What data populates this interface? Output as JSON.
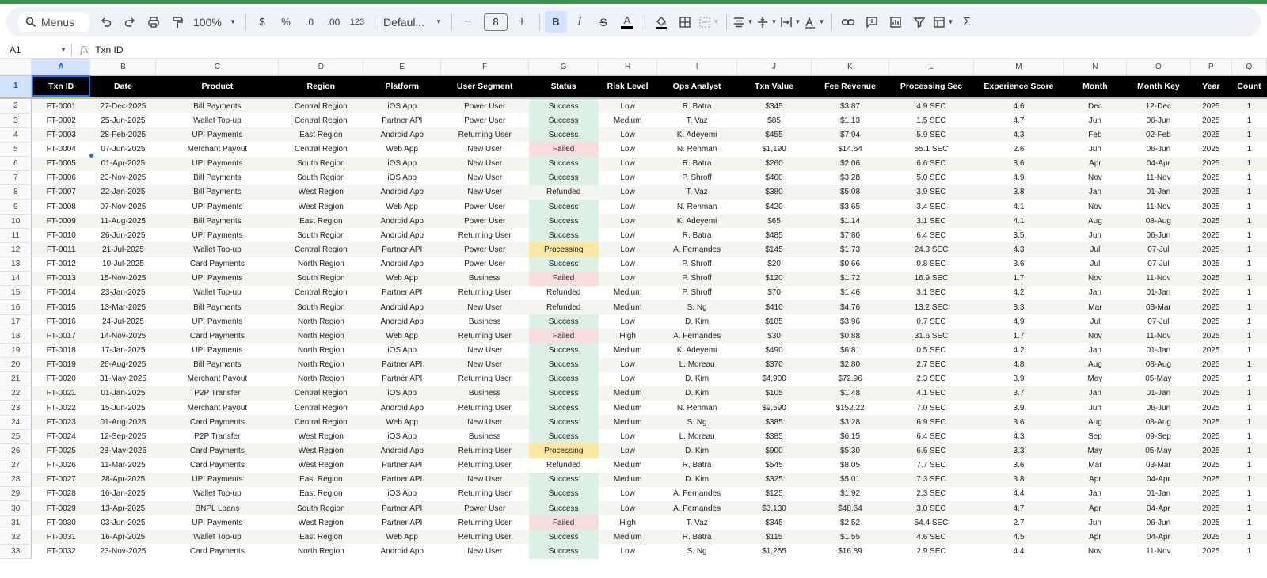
{
  "toolbar": {
    "menus_label": "Menus",
    "zoom": "100%",
    "currency": "$",
    "percent": "%",
    "dec_decrease": ".0",
    "dec_increase": ".00",
    "number_format": "123",
    "font": "Defaul...",
    "font_size": "8",
    "bold": "B",
    "italic": "I",
    "strikethrough": "S",
    "text_color": "A",
    "sigma": "Σ",
    "minus": "−",
    "plus": "+"
  },
  "formula_bar": {
    "cell_ref": "A1",
    "fx": "fx",
    "content": "Txn ID"
  },
  "column_letters": [
    "A",
    "B",
    "C",
    "D",
    "E",
    "F",
    "G",
    "H",
    "I",
    "J",
    "K",
    "L",
    "M",
    "N",
    "O",
    "P",
    "Q"
  ],
  "header_row_number": "1",
  "headers": [
    "Txn ID",
    "Date",
    "Product",
    "Region",
    "Platform",
    "User Segment",
    "Status",
    "Risk Level",
    "Ops Analyst",
    "Txn Value",
    "Fee Revenue",
    "Processing Sec",
    "Experience Score",
    "Month",
    "Month Key",
    "Year",
    "Count"
  ],
  "rows": [
    [
      "2",
      "FT-0001",
      "27-Dec-2025",
      "Bill Payments",
      "Central Region",
      "iOS App",
      "Power User",
      "Success",
      "Low",
      "R. Batra",
      "$345",
      "$3.87",
      "4.9 SEC",
      "4.6",
      "Dec",
      "12-Dec",
      "2025",
      "1"
    ],
    [
      "3",
      "FT-0002",
      "25-Jun-2025",
      "Wallet Top-up",
      "Central Region",
      "Partner API",
      "Power User",
      "Success",
      "Medium",
      "T. Vaz",
      "$85",
      "$1.13",
      "1.5 SEC",
      "4.7",
      "Jun",
      "06-Jun",
      "2025",
      "1"
    ],
    [
      "4",
      "FT-0003",
      "28-Feb-2025",
      "UPI Payments",
      "East Region",
      "Android App",
      "Returning User",
      "Success",
      "Low",
      "K. Adeyemi",
      "$455",
      "$7.94",
      "5.9 SEC",
      "4.3",
      "Feb",
      "02-Feb",
      "2025",
      "1"
    ],
    [
      "5",
      "FT-0004",
      "07-Jun-2025",
      "Merchant Payout",
      "Central Region",
      "Web App",
      "New User",
      "Failed",
      "Low",
      "N. Rehman",
      "$1,190",
      "$14.64",
      "55.1 SEC",
      "2.6",
      "Jun",
      "06-Jun",
      "2025",
      "1"
    ],
    [
      "6",
      "FT-0005",
      "01-Apr-2025",
      "UPI Payments",
      "South Region",
      "iOS App",
      "New User",
      "Success",
      "Low",
      "R. Batra",
      "$260",
      "$2.06",
      "6.6 SEC",
      "3.6",
      "Apr",
      "04-Apr",
      "2025",
      "1"
    ],
    [
      "7",
      "FT-0006",
      "23-Nov-2025",
      "Bill Payments",
      "South Region",
      "iOS App",
      "New User",
      "Success",
      "Low",
      "P. Shroff",
      "$460",
      "$3.28",
      "5.0 SEC",
      "4.9",
      "Nov",
      "11-Nov",
      "2025",
      "1"
    ],
    [
      "8",
      "FT-0007",
      "22-Jan-2025",
      "Bill Payments",
      "West Region",
      "Android App",
      "New User",
      "Refunded",
      "Low",
      "T. Vaz",
      "$380",
      "$5.08",
      "3.9 SEC",
      "3.8",
      "Jan",
      "01-Jan",
      "2025",
      "1"
    ],
    [
      "9",
      "FT-0008",
      "07-Nov-2025",
      "UPI Payments",
      "West Region",
      "Web App",
      "Power User",
      "Success",
      "Low",
      "N. Rehman",
      "$420",
      "$3.65",
      "3.4 SEC",
      "4.1",
      "Nov",
      "11-Nov",
      "2025",
      "1"
    ],
    [
      "10",
      "FT-0009",
      "11-Aug-2025",
      "Bill Payments",
      "East Region",
      "Android App",
      "Power User",
      "Success",
      "Low",
      "K. Adeyemi",
      "$65",
      "$1.14",
      "3.1 SEC",
      "4.1",
      "Aug",
      "08-Aug",
      "2025",
      "1"
    ],
    [
      "11",
      "FT-0010",
      "26-Jun-2025",
      "UPI Payments",
      "South Region",
      "Android App",
      "Returning User",
      "Success",
      "Low",
      "R. Batra",
      "$485",
      "$7.80",
      "6.4 SEC",
      "3.5",
      "Jun",
      "06-Jun",
      "2025",
      "1"
    ],
    [
      "12",
      "FT-0011",
      "21-Jul-2025",
      "Wallet Top-up",
      "Central Region",
      "Partner API",
      "Power User",
      "Processing",
      "Low",
      "A. Fernandes",
      "$145",
      "$1.73",
      "24.3 SEC",
      "4.3",
      "Jul",
      "07-Jul",
      "2025",
      "1"
    ],
    [
      "13",
      "FT-0012",
      "10-Jul-2025",
      "Card Payments",
      "North Region",
      "Android App",
      "Power User",
      "Success",
      "Low",
      "P. Shroff",
      "$20",
      "$0.66",
      "0.8 SEC",
      "3.6",
      "Jul",
      "07-Jul",
      "2025",
      "1"
    ],
    [
      "14",
      "FT-0013",
      "15-Nov-2025",
      "UPI Payments",
      "South Region",
      "Web App",
      "Business",
      "Failed",
      "Low",
      "P. Shroff",
      "$120",
      "$1.72",
      "16.9 SEC",
      "1.7",
      "Nov",
      "11-Nov",
      "2025",
      "1"
    ],
    [
      "15",
      "FT-0014",
      "23-Jan-2025",
      "Wallet Top-up",
      "Central Region",
      "Partner API",
      "Returning User",
      "Refunded",
      "Medium",
      "P. Shroff",
      "$70",
      "$1.46",
      "3.1 SEC",
      "4.2",
      "Jan",
      "01-Jan",
      "2025",
      "1"
    ],
    [
      "16",
      "FT-0015",
      "13-Mar-2025",
      "Bill Payments",
      "South Region",
      "Android App",
      "New User",
      "Refunded",
      "Medium",
      "S. Ng",
      "$410",
      "$4.76",
      "13.2 SEC",
      "3.3",
      "Mar",
      "03-Mar",
      "2025",
      "1"
    ],
    [
      "17",
      "FT-0016",
      "24-Jul-2025",
      "UPI Payments",
      "North Region",
      "Android App",
      "Business",
      "Success",
      "Low",
      "D. Kim",
      "$185",
      "$3.96",
      "0.7 SEC",
      "4.9",
      "Jul",
      "07-Jul",
      "2025",
      "1"
    ],
    [
      "18",
      "FT-0017",
      "14-Nov-2025",
      "Card Payments",
      "North Region",
      "Web App",
      "Returning User",
      "Failed",
      "High",
      "A. Fernandes",
      "$30",
      "$0.88",
      "31.6 SEC",
      "1.7",
      "Nov",
      "11-Nov",
      "2025",
      "1"
    ],
    [
      "19",
      "FT-0018",
      "17-Jan-2025",
      "UPI Payments",
      "North Region",
      "iOS App",
      "New User",
      "Success",
      "Medium",
      "K. Adeyemi",
      "$490",
      "$6.81",
      "0.5 SEC",
      "4.2",
      "Jan",
      "01-Jan",
      "2025",
      "1"
    ],
    [
      "20",
      "FT-0019",
      "26-Aug-2025",
      "Bill Payments",
      "North Region",
      "Partner API",
      "New User",
      "Success",
      "Low",
      "L. Moreau",
      "$370",
      "$2.80",
      "2.7 SEC",
      "4.8",
      "Aug",
      "08-Aug",
      "2025",
      "1"
    ],
    [
      "21",
      "FT-0020",
      "31-May-2025",
      "Merchant Payout",
      "North Region",
      "Partner API",
      "Returning User",
      "Success",
      "Low",
      "D. Kim",
      "$4,900",
      "$72.96",
      "2.3 SEC",
      "3.9",
      "May",
      "05-May",
      "2025",
      "1"
    ],
    [
      "22",
      "FT-0021",
      "01-Jan-2025",
      "P2P Transfer",
      "Central Region",
      "iOS App",
      "Business",
      "Success",
      "Medium",
      "D. Kim",
      "$105",
      "$1.48",
      "4.1 SEC",
      "3.7",
      "Jan",
      "01-Jan",
      "2025",
      "1"
    ],
    [
      "23",
      "FT-0022",
      "15-Jun-2025",
      "Merchant Payout",
      "Central Region",
      "Android App",
      "Returning User",
      "Success",
      "Medium",
      "N. Rehman",
      "$9,590",
      "$152.22",
      "7.0 SEC",
      "3.9",
      "Jun",
      "06-Jun",
      "2025",
      "1"
    ],
    [
      "24",
      "FT-0023",
      "01-Aug-2025",
      "Card Payments",
      "Central Region",
      "Web App",
      "New User",
      "Success",
      "Medium",
      "S. Ng",
      "$385",
      "$3.28",
      "6.9 SEC",
      "3.6",
      "Aug",
      "08-Aug",
      "2025",
      "1"
    ],
    [
      "25",
      "FT-0024",
      "12-Sep-2025",
      "P2P Transfer",
      "West Region",
      "iOS App",
      "Business",
      "Success",
      "Low",
      "L. Moreau",
      "$385",
      "$6.15",
      "6.4 SEC",
      "4.3",
      "Sep",
      "09-Sep",
      "2025",
      "1"
    ],
    [
      "26",
      "FT-0025",
      "28-May-2025",
      "Card Payments",
      "West Region",
      "Android App",
      "Returning User",
      "Processing",
      "Low",
      "D. Kim",
      "$900",
      "$5.30",
      "6.6 SEC",
      "3.3",
      "May",
      "05-May",
      "2025",
      "1"
    ],
    [
      "27",
      "FT-0026",
      "11-Mar-2025",
      "Card Payments",
      "West Region",
      "Partner API",
      "Returning User",
      "Refunded",
      "Medium",
      "R. Batra",
      "$545",
      "$8.05",
      "7.7 SEC",
      "3.6",
      "Mar",
      "03-Mar",
      "2025",
      "1"
    ],
    [
      "28",
      "FT-0027",
      "28-Apr-2025",
      "UPI Payments",
      "East Region",
      "Partner API",
      "New User",
      "Success",
      "Medium",
      "D. Kim",
      "$325",
      "$5.01",
      "7.3 SEC",
      "3.8",
      "Apr",
      "04-Apr",
      "2025",
      "1"
    ],
    [
      "29",
      "FT-0028",
      "16-Jan-2025",
      "Wallet Top-up",
      "East Region",
      "iOS App",
      "Returning User",
      "Success",
      "Low",
      "A. Fernandes",
      "$125",
      "$1.92",
      "2.3 SEC",
      "4.4",
      "Jan",
      "01-Jan",
      "2025",
      "1"
    ],
    [
      "30",
      "FT-0029",
      "13-Apr-2025",
      "BNPL Loans",
      "South Region",
      "Partner API",
      "Power User",
      "Success",
      "Low",
      "A. Fernandes",
      "$3,130",
      "$48.64",
      "3.0 SEC",
      "4.7",
      "Apr",
      "04-Apr",
      "2025",
      "1"
    ],
    [
      "31",
      "FT-0030",
      "03-Jun-2025",
      "UPI Payments",
      "West Region",
      "Partner API",
      "Returning User",
      "Failed",
      "High",
      "T. Vaz",
      "$345",
      "$2.52",
      "54.4 SEC",
      "2.7",
      "Jun",
      "06-Jun",
      "2025",
      "1"
    ],
    [
      "32",
      "FT-0031",
      "16-Apr-2025",
      "Wallet Top-up",
      "East Region",
      "Web App",
      "Returning User",
      "Success",
      "Medium",
      "R. Batra",
      "$115",
      "$1.55",
      "4.6 SEC",
      "4.5",
      "Apr",
      "04-Apr",
      "2025",
      "1"
    ],
    [
      "33",
      "FT-0032",
      "23-Nov-2025",
      "Card Payments",
      "North Region",
      "Android App",
      "New User",
      "Success",
      "Low",
      "S. Ng",
      "$1,255",
      "$16.89",
      "2.9 SEC",
      "4.4",
      "Nov",
      "11-Nov",
      "2025",
      "1"
    ]
  ],
  "colors": {
    "header_bg": "#000000",
    "success_fill": "#dcf1e3",
    "failed_fill": "#f9dcdc",
    "processing_fill": "#fce8a4",
    "band_fill": "#f3f6ef",
    "accent": "#1a73e8"
  }
}
